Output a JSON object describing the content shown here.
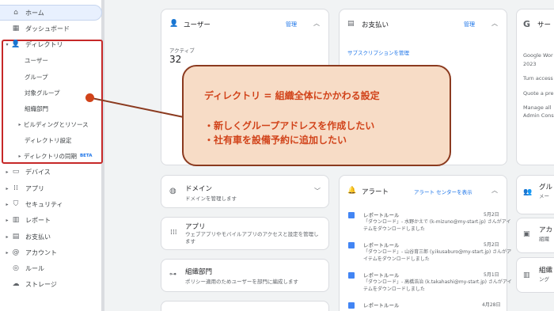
{
  "sidebar": {
    "home": "ホーム",
    "dashboard": "ダッシュボード",
    "directory": "ディレクトリ",
    "users": "ユーザー",
    "groups": "グループ",
    "target_groups": "対象グループ",
    "org_units": "組織部門",
    "buildings": "ビルディングとリソース",
    "directory_settings": "ディレクトリ設定",
    "directory_sync": "ディレクトリの同期",
    "beta": "BETA",
    "devices": "デバイス",
    "apps": "アプリ",
    "security": "セキュリティ",
    "reports": "レポート",
    "billing": "お支払い",
    "account": "アカウント",
    "rules": "ルール",
    "storage": "ストレージ"
  },
  "cards": {
    "users": {
      "title": "ユーザー",
      "manage": "管理",
      "active_label": "アクティブ",
      "active_count": "32"
    },
    "billing": {
      "title": "お支払い",
      "manage": "管理",
      "sub_link": "サブスクリプションを管理"
    },
    "google": {
      "title": "サー",
      "line1": "Google Wor",
      "line2": "2023",
      "line3": "Turn access",
      "line4": "Quote a pre",
      "line5": "Manage all",
      "line6": "Admin Cons"
    },
    "domain": {
      "title": "ドメイン",
      "desc": "ドメインを管理します"
    },
    "apps": {
      "title": "アプリ",
      "desc": "ウェブアプリやモバイルアプリのアクセスと設定を管理します"
    },
    "org": {
      "title": "組織部門",
      "desc": "ポリシー適用のためユーザーを部門に編成します"
    },
    "alerts": {
      "title": "アラート",
      "link": "アラート センターを表示",
      "items": [
        {
          "title": "レポートルール",
          "date": "5月2日",
          "desc": "「ダウンロード」- 水野かえで (k-mizuno@my-start.jp) さんがアイテムをダウンロードしました"
        },
        {
          "title": "レポートルール",
          "date": "5月2日",
          "desc": "「ダウンロード」- 山谷育三郎 (y.ikusaburo@my-start.jp) さんがアイテムをダウンロードしました"
        },
        {
          "title": "レポートルール",
          "date": "5月1日",
          "desc": "「ダウンロード」- 高橋浩治 (k.takahashi@my-start.jp) さんがアイテムをダウンロードしました"
        },
        {
          "title": "レポートルール",
          "date": "4月28日",
          "desc": ""
        }
      ]
    },
    "right_group": {
      "title": "グル",
      "desc": "メー"
    },
    "right_account": {
      "title": "アカ",
      "desc": "組織"
    },
    "right_org": {
      "title": "組織",
      "desc": "ング"
    }
  },
  "callout": {
    "line1": "ディレクトリ = 組織全体にかかわる設定",
    "line2": "・新しくグループアドレスを作成したい",
    "line3": "・社有車を設備予約に追加したい"
  },
  "colors": {
    "accent": "#1a73e8",
    "callout_bg": "#f7dcc6",
    "callout_text": "#d1431a",
    "highlight": "#c62828"
  }
}
